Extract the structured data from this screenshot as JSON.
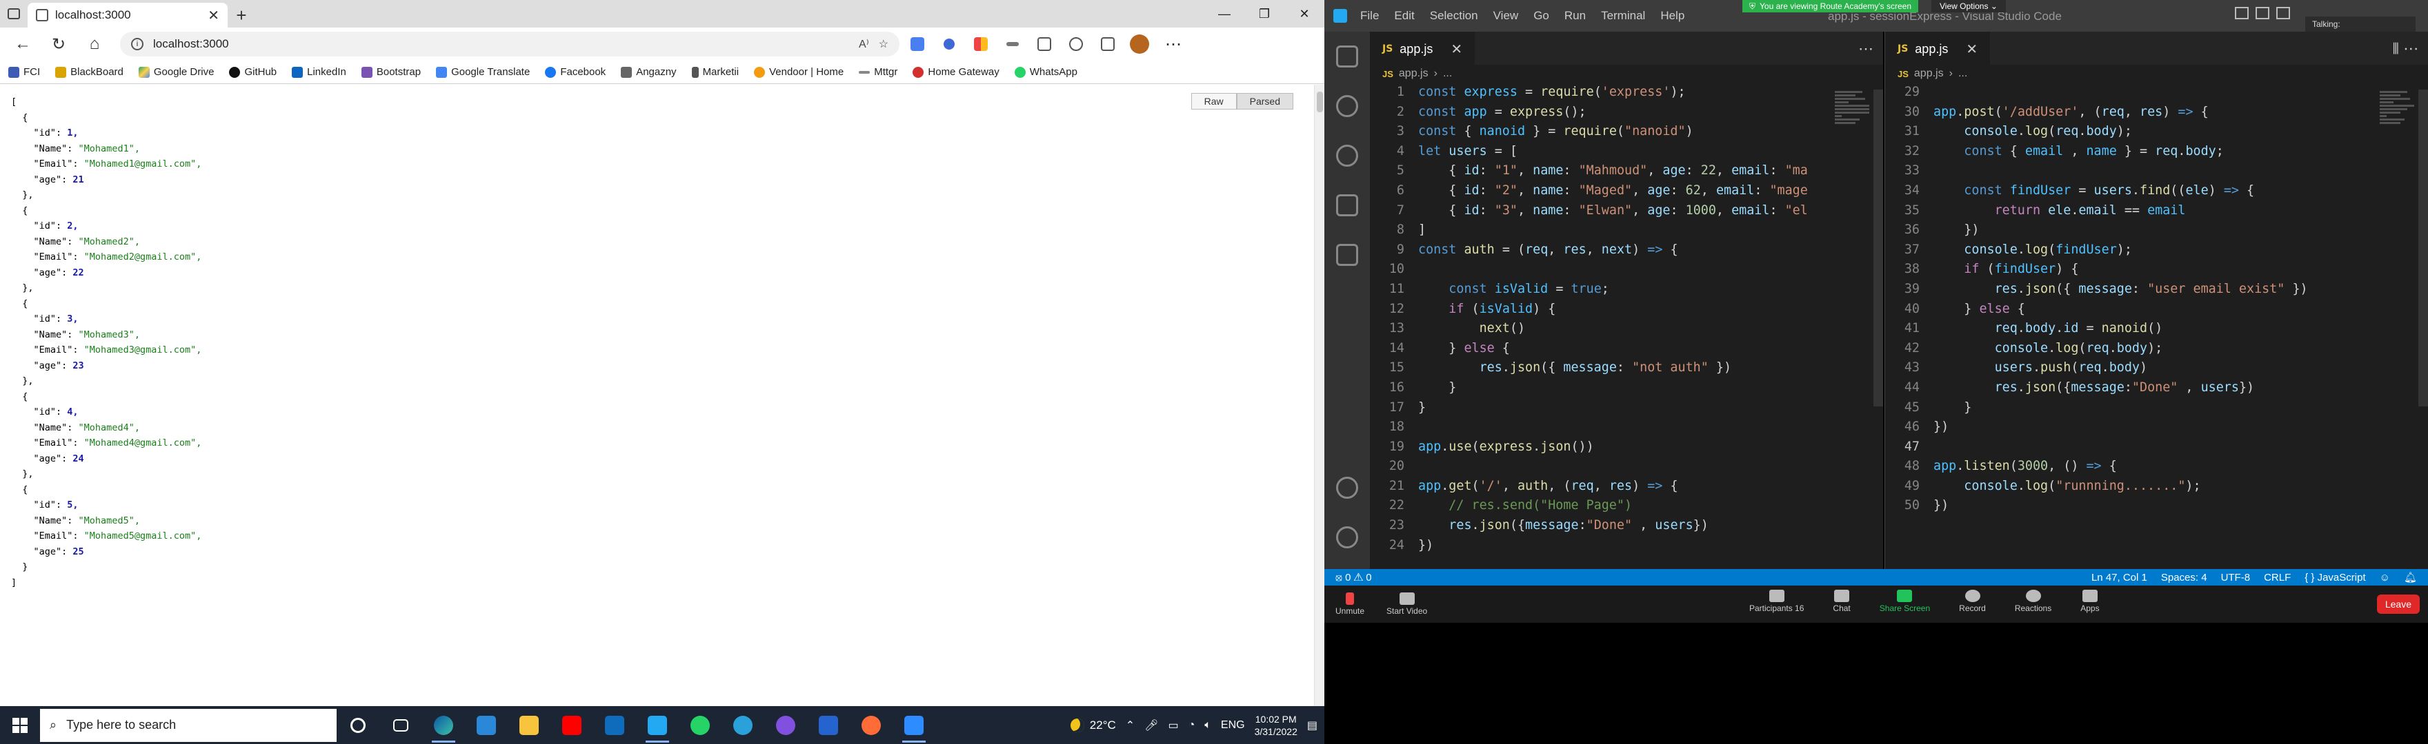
{
  "browser": {
    "tab_title": "localhost:3000",
    "url": "localhost:3000",
    "bookmarks": [
      "FCI",
      "BlackBoard",
      "Google Drive",
      "GitHub",
      "LinkedIn",
      "Bootstrap",
      "Google Translate",
      "Facebook",
      "Angazny",
      "Marketii",
      "Vendoor | Home",
      "Mttgr",
      "Home Gateway",
      "WhatsApp"
    ],
    "view_toggle": {
      "raw": "Raw",
      "parsed": "Parsed"
    },
    "json_lines": [
      {
        "t": "[",
        "cls": ""
      },
      {
        "t": "  {",
        "cls": ""
      },
      {
        "t": "    \"id\": ",
        "v": "1,",
        "vt": "num"
      },
      {
        "t": "    \"Name\": ",
        "v": "\"Mohamed1\",",
        "vt": "str"
      },
      {
        "t": "    \"Email\": ",
        "v": "\"Mohamed1@gmail.com\",",
        "vt": "str"
      },
      {
        "t": "    \"age\": ",
        "v": "21",
        "vt": "num"
      },
      {
        "t": "  },",
        "cls": ""
      },
      {
        "t": "  {",
        "cls": ""
      },
      {
        "t": "    \"id\": ",
        "v": "2,",
        "vt": "num"
      },
      {
        "t": "    \"Name\": ",
        "v": "\"Mohamed2\",",
        "vt": "str"
      },
      {
        "t": "    \"Email\": ",
        "v": "\"Mohamed2@gmail.com\",",
        "vt": "str"
      },
      {
        "t": "    \"age\": ",
        "v": "22",
        "vt": "num"
      },
      {
        "t": "  },",
        "cls": ""
      },
      {
        "t": "  {",
        "cls": ""
      },
      {
        "t": "    \"id\": ",
        "v": "3,",
        "vt": "num"
      },
      {
        "t": "    \"Name\": ",
        "v": "\"Mohamed3\",",
        "vt": "str"
      },
      {
        "t": "    \"Email\": ",
        "v": "\"Mohamed3@gmail.com\",",
        "vt": "str"
      },
      {
        "t": "    \"age\": ",
        "v": "23",
        "vt": "num"
      },
      {
        "t": "  },",
        "cls": ""
      },
      {
        "t": "  {",
        "cls": ""
      },
      {
        "t": "    \"id\": ",
        "v": "4,",
        "vt": "num"
      },
      {
        "t": "    \"Name\": ",
        "v": "\"Mohamed4\",",
        "vt": "str"
      },
      {
        "t": "    \"Email\": ",
        "v": "\"Mohamed4@gmail.com\",",
        "vt": "str"
      },
      {
        "t": "    \"age\": ",
        "v": "24",
        "vt": "num"
      },
      {
        "t": "  },",
        "cls": ""
      },
      {
        "t": "  {",
        "cls": ""
      },
      {
        "t": "    \"id\": ",
        "v": "5,",
        "vt": "num"
      },
      {
        "t": "    \"Name\": ",
        "v": "\"Mohamed5\",",
        "vt": "str"
      },
      {
        "t": "    \"Email\": ",
        "v": "\"Mohamed5@gmail.com\",",
        "vt": "str"
      },
      {
        "t": "    \"age\": ",
        "v": "25",
        "vt": "num"
      },
      {
        "t": "  }",
        "cls": ""
      },
      {
        "t": "]",
        "cls": ""
      }
    ]
  },
  "taskbar": {
    "search_placeholder": "Type here to search",
    "weather": "22°C",
    "lang": "ENG",
    "time": "10:02 PM",
    "date": "3/31/2022"
  },
  "vscode": {
    "menu": [
      "File",
      "Edit",
      "Selection",
      "View",
      "Go",
      "Run",
      "Terminal",
      "Help"
    ],
    "window_title": "app.js - sessionExpress - Visual Studio Code",
    "share_banner": "You are viewing Route Academy's screen",
    "view_options": "View Options",
    "talking": "Talking:",
    "tab_left": "app.js",
    "tab_right": "app.js",
    "breadcrumb_file": "app.js",
    "breadcrumb_more": "...",
    "left_code": [
      {
        "n": "1",
        "h": "<span class='k'>const</span> <span class='cv'>express</span> = <span class='f'>require</span>(<span class='s'>'express'</span>);"
      },
      {
        "n": "2",
        "h": "<span class='k'>const</span> <span class='cv'>app</span> = <span class='f'>express</span>();"
      },
      {
        "n": "3",
        "h": "<span class='k'>const</span> { <span class='cv'>nanoid</span> } = <span class='f'>require</span>(<span class='s'>\"nanoid\"</span>)"
      },
      {
        "n": "4",
        "h": "<span class='k'>let</span> <span class='v'>users</span> = ["
      },
      {
        "n": "5",
        "h": "    { <span class='v'>id</span>: <span class='s'>\"1\"</span>, <span class='v'>name</span>: <span class='s'>\"Mahmoud\"</span>, <span class='v'>age</span>: <span class='n'>22</span>, <span class='v'>email</span>: <span class='s'>\"ma</span>"
      },
      {
        "n": "6",
        "h": "    { <span class='v'>id</span>: <span class='s'>\"2\"</span>, <span class='v'>name</span>: <span class='s'>\"Maged\"</span>, <span class='v'>age</span>: <span class='n'>62</span>, <span class='v'>email</span>: <span class='s'>\"mage</span>"
      },
      {
        "n": "7",
        "h": "    { <span class='v'>id</span>: <span class='s'>\"3\"</span>, <span class='v'>name</span>: <span class='s'>\"Elwan\"</span>, <span class='v'>age</span>: <span class='n'>1000</span>, <span class='v'>email</span>: <span class='s'>\"el</span>"
      },
      {
        "n": "8",
        "h": "]"
      },
      {
        "n": "9",
        "h": "<span class='k'>const</span> <span class='f'>auth</span> = (<span class='v'>req</span>, <span class='v'>res</span>, <span class='v'>next</span>) <span class='k'>=&gt;</span> {"
      },
      {
        "n": "10",
        "h": ""
      },
      {
        "n": "11",
        "h": "    <span class='k'>const</span> <span class='cv'>isValid</span> = <span class='k'>true</span>;"
      },
      {
        "n": "12",
        "h": "    <span class='kc'>if</span> (<span class='cv'>isValid</span>) {"
      },
      {
        "n": "13",
        "h": "        <span class='f'>next</span>()"
      },
      {
        "n": "14",
        "h": "    } <span class='kc'>else</span> {"
      },
      {
        "n": "15",
        "h": "        <span class='v'>res</span>.<span class='f'>json</span>({ <span class='v'>message</span>: <span class='s'>\"not auth\"</span> })"
      },
      {
        "n": "16",
        "h": "    }"
      },
      {
        "n": "17",
        "h": "}"
      },
      {
        "n": "18",
        "h": ""
      },
      {
        "n": "19",
        "h": "<span class='cv'>app</span>.<span class='f'>use</span>(<span class='f'>express</span>.<span class='f'>json</span>())"
      },
      {
        "n": "20",
        "h": ""
      },
      {
        "n": "21",
        "h": "<span class='cv'>app</span>.<span class='f'>get</span>(<span class='s'>'/'</span>, <span class='f'>auth</span>, (<span class='v'>req</span>, <span class='v'>res</span>) <span class='k'>=&gt;</span> {"
      },
      {
        "n": "22",
        "h": "    <span class='c'>// res.send(\"Home Page\")</span>"
      },
      {
        "n": "23",
        "h": "    <span class='v'>res</span>.<span class='f'>json</span>({<span class='v'>message</span>:<span class='s'>\"Done\"</span> , <span class='v'>users</span>})"
      },
      {
        "n": "24",
        "h": "})"
      }
    ],
    "right_code": [
      {
        "n": "29",
        "h": ""
      },
      {
        "n": "30",
        "h": "<span class='cv'>app</span>.<span class='f'>post</span>(<span class='s'>'/addUser'</span>, (<span class='v'>req</span>, <span class='v'>res</span>) <span class='k'>=&gt;</span> {"
      },
      {
        "n": "31",
        "h": "    <span class='v'>console</span>.<span class='f'>log</span>(<span class='v'>req</span>.<span class='v'>body</span>);"
      },
      {
        "n": "32",
        "h": "    <span class='k'>const</span> { <span class='cv'>email</span> , <span class='cv'>name</span> } = <span class='v'>req</span>.<span class='v'>body</span>;"
      },
      {
        "n": "33",
        "h": ""
      },
      {
        "n": "34",
        "h": "    <span class='k'>const</span> <span class='cv'>findUser</span> = <span class='v'>users</span>.<span class='f'>find</span>((<span class='v'>ele</span>) <span class='k'>=&gt;</span> {"
      },
      {
        "n": "35",
        "h": "        <span class='kc'>return</span> <span class='v'>ele</span>.<span class='v'>email</span> == <span class='cv'>email</span>"
      },
      {
        "n": "36",
        "h": "    })"
      },
      {
        "n": "37",
        "h": "    <span class='v'>console</span>.<span class='f'>log</span>(<span class='cv'>findUser</span>);"
      },
      {
        "n": "38",
        "h": "    <span class='kc'>if</span> (<span class='cv'>findUser</span>) {"
      },
      {
        "n": "39",
        "h": "        <span class='v'>res</span>.<span class='f'>json</span>({ <span class='v'>message</span>: <span class='s'>\"user email exist\"</span> })"
      },
      {
        "n": "40",
        "h": "    } <span class='kc'>else</span> {"
      },
      {
        "n": "41",
        "h": "        <span class='v'>req</span>.<span class='v'>body</span>.<span class='v'>id</span> = <span class='f'>nanoid</span>()"
      },
      {
        "n": "42",
        "h": "        <span class='v'>console</span>.<span class='f'>log</span>(<span class='v'>req</span>.<span class='v'>body</span>);"
      },
      {
        "n": "43",
        "h": "        <span class='v'>users</span>.<span class='f'>push</span>(<span class='v'>req</span>.<span class='v'>body</span>)"
      },
      {
        "n": "44",
        "h": "        <span class='v'>res</span>.<span class='f'>json</span>({<span class='v'>message</span>:<span class='s'>\"Done\"</span> , <span class='v'>users</span>})"
      },
      {
        "n": "45",
        "h": "    }"
      },
      {
        "n": "46",
        "h": "})"
      },
      {
        "n": "47",
        "h": "",
        "cur": true
      },
      {
        "n": "48",
        "h": "<span class='cv'>app</span>.<span class='f'>listen</span>(<span class='n'>3000</span>, () <span class='k'>=&gt;</span> {"
      },
      {
        "n": "49",
        "h": "    <span class='v'>console</span>.<span class='f'>log</span>(<span class='s'>\"runnning.......\"</span>);"
      },
      {
        "n": "50",
        "h": "})"
      }
    ],
    "status": {
      "problems": "⦻ 0 ⚠ 0",
      "position": "Ln 47, Col 1",
      "spaces": "Spaces: 4",
      "encoding": "UTF-8",
      "eol": "CRLF",
      "language": "{ } JavaScript"
    }
  },
  "zoom": {
    "unmute": "Unmute",
    "start_video": "Start Video",
    "participants": "Participants",
    "participants_count": "16",
    "chat": "Chat",
    "share_screen": "Share Screen",
    "record": "Record",
    "reactions": "Reactions",
    "apps": "Apps",
    "leave": "Leave"
  }
}
